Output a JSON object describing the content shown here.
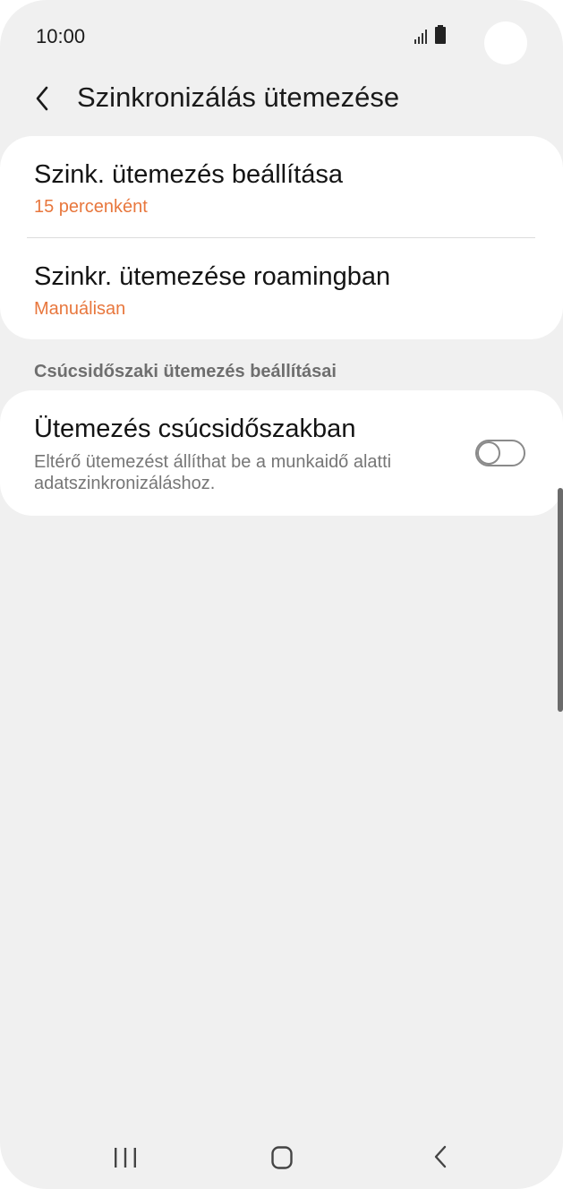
{
  "status_bar": {
    "time": "10:00",
    "icons": [
      "signal-icon",
      "battery-icon"
    ]
  },
  "header": {
    "title": "Szinkronizálás ütemezése",
    "back_icon": "back-icon"
  },
  "sync_card": {
    "items": [
      {
        "title": "Szink. ütemezés beállítása",
        "value": "15 percenként"
      },
      {
        "title": "Szinkr. ütemezése roamingban",
        "value": "Manuálisan"
      }
    ]
  },
  "peak_section": {
    "header": "Csúcsidőszaki ütemezés beállításai",
    "item": {
      "title": "Ütemezés csúcsidőszakban",
      "description": "Eltérő ütemezést állíthat be a munkaidő alatti adatszinkronizáláshoz.",
      "toggle_on": false
    }
  },
  "nav_bar": {
    "buttons": [
      "recents-icon",
      "home-icon",
      "back-icon"
    ]
  },
  "colors": {
    "background": "#f0f0f0",
    "card": "#ffffff",
    "accent": "#e8773d",
    "text": "#141414",
    "secondary_text": "#767676"
  }
}
